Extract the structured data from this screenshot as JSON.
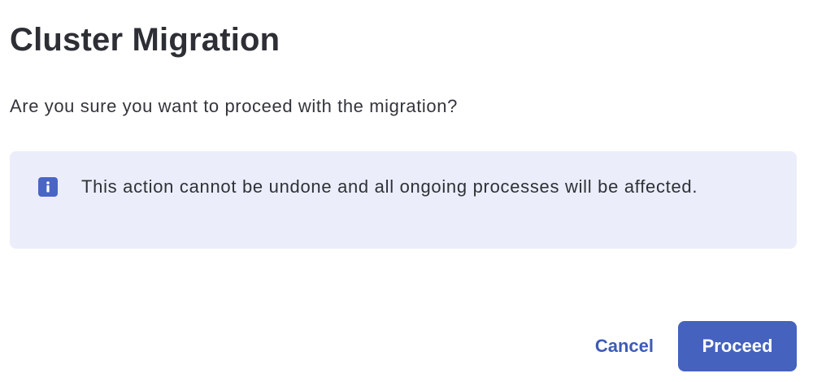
{
  "dialog": {
    "title": "Cluster Migration",
    "message": "Are you sure you want to proceed with the migration?",
    "callout": {
      "icon": "info-icon",
      "text": "This action cannot be undone and all ongoing processes will be affected."
    },
    "actions": {
      "cancel_label": "Cancel",
      "proceed_label": "Proceed"
    }
  },
  "colors": {
    "accent": "#4562be",
    "callout_bg": "#ebeefa",
    "text": "#2d2f35"
  }
}
